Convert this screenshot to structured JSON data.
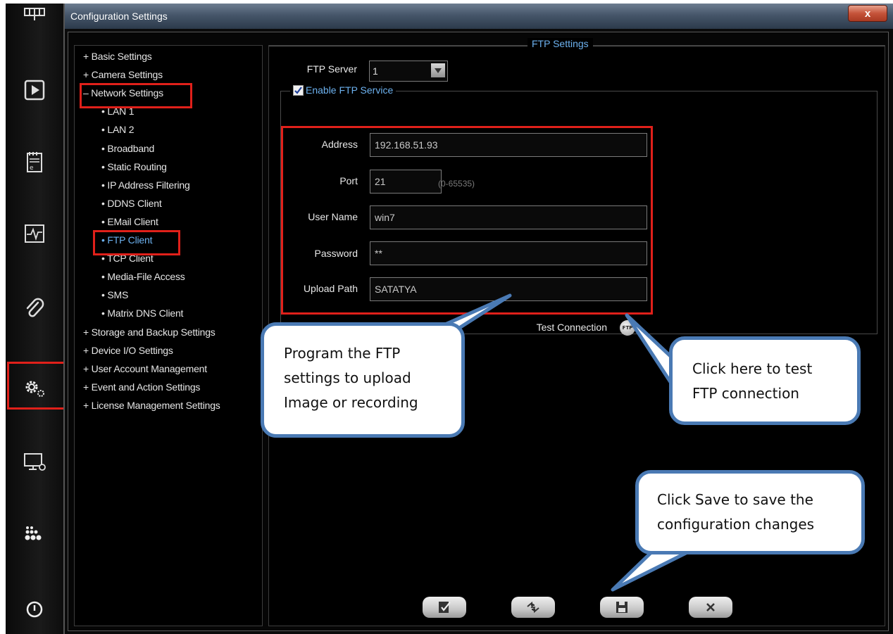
{
  "window": {
    "title": "Configuration Settings",
    "close_label": "x"
  },
  "dock": {
    "icons": [
      "layout-grid-icon",
      "play-icon",
      "notepad-icon",
      "activity-monitor-icon",
      "paperclip-icon",
      "settings-gears-icon",
      "display-settings-icon",
      "dot-grid-icon",
      "power-icon"
    ]
  },
  "tree": {
    "items": [
      {
        "label": "+ Basic Settings"
      },
      {
        "label": "+ Camera Settings"
      },
      {
        "label": "– Network Settings"
      },
      {
        "label": "• LAN 1"
      },
      {
        "label": "• LAN 2"
      },
      {
        "label": "• Broadband"
      },
      {
        "label": "• Static Routing"
      },
      {
        "label": "• IP Address Filtering"
      },
      {
        "label": "• DDNS Client"
      },
      {
        "label": "• EMail Client"
      },
      {
        "label": "• FTP Client"
      },
      {
        "label": "• TCP Client"
      },
      {
        "label": "• Media-File Access"
      },
      {
        "label": "• SMS"
      },
      {
        "label": "• Matrix DNS Client"
      },
      {
        "label": "+ Storage and Backup Settings"
      },
      {
        "label": "+ Device I/O Settings"
      },
      {
        "label": "+ User Account Management"
      },
      {
        "label": "+ Event and Action Settings"
      },
      {
        "label": "+ License Management Settings"
      }
    ]
  },
  "ftp": {
    "section_title": "FTP Settings",
    "server_label": "FTP Server",
    "server_value": "1",
    "enable_label": "Enable FTP Service",
    "enabled": true,
    "fields": {
      "address": {
        "label": "Address",
        "value": "192.168.51.93"
      },
      "port": {
        "label": "Port",
        "value": "21",
        "hint": "(0-65535)"
      },
      "username": {
        "label": "User Name",
        "value": "win7"
      },
      "password": {
        "label": "Password",
        "value": "**"
      },
      "upload_path": {
        "label": "Upload Path",
        "value": "SATATYA"
      }
    },
    "test_label": "Test Connection",
    "test_icon_text": "FTP"
  },
  "callouts": {
    "program": [
      "Program the FTP",
      "settings to upload",
      "Image or recording"
    ],
    "test": [
      "Click here to test",
      "FTP connection"
    ],
    "save": [
      "Click Save to save the",
      "configuration changes"
    ]
  },
  "colors": {
    "highlight": "#e0201a",
    "callout_border": "#4a7ab4",
    "accent": "#6db2f0"
  }
}
